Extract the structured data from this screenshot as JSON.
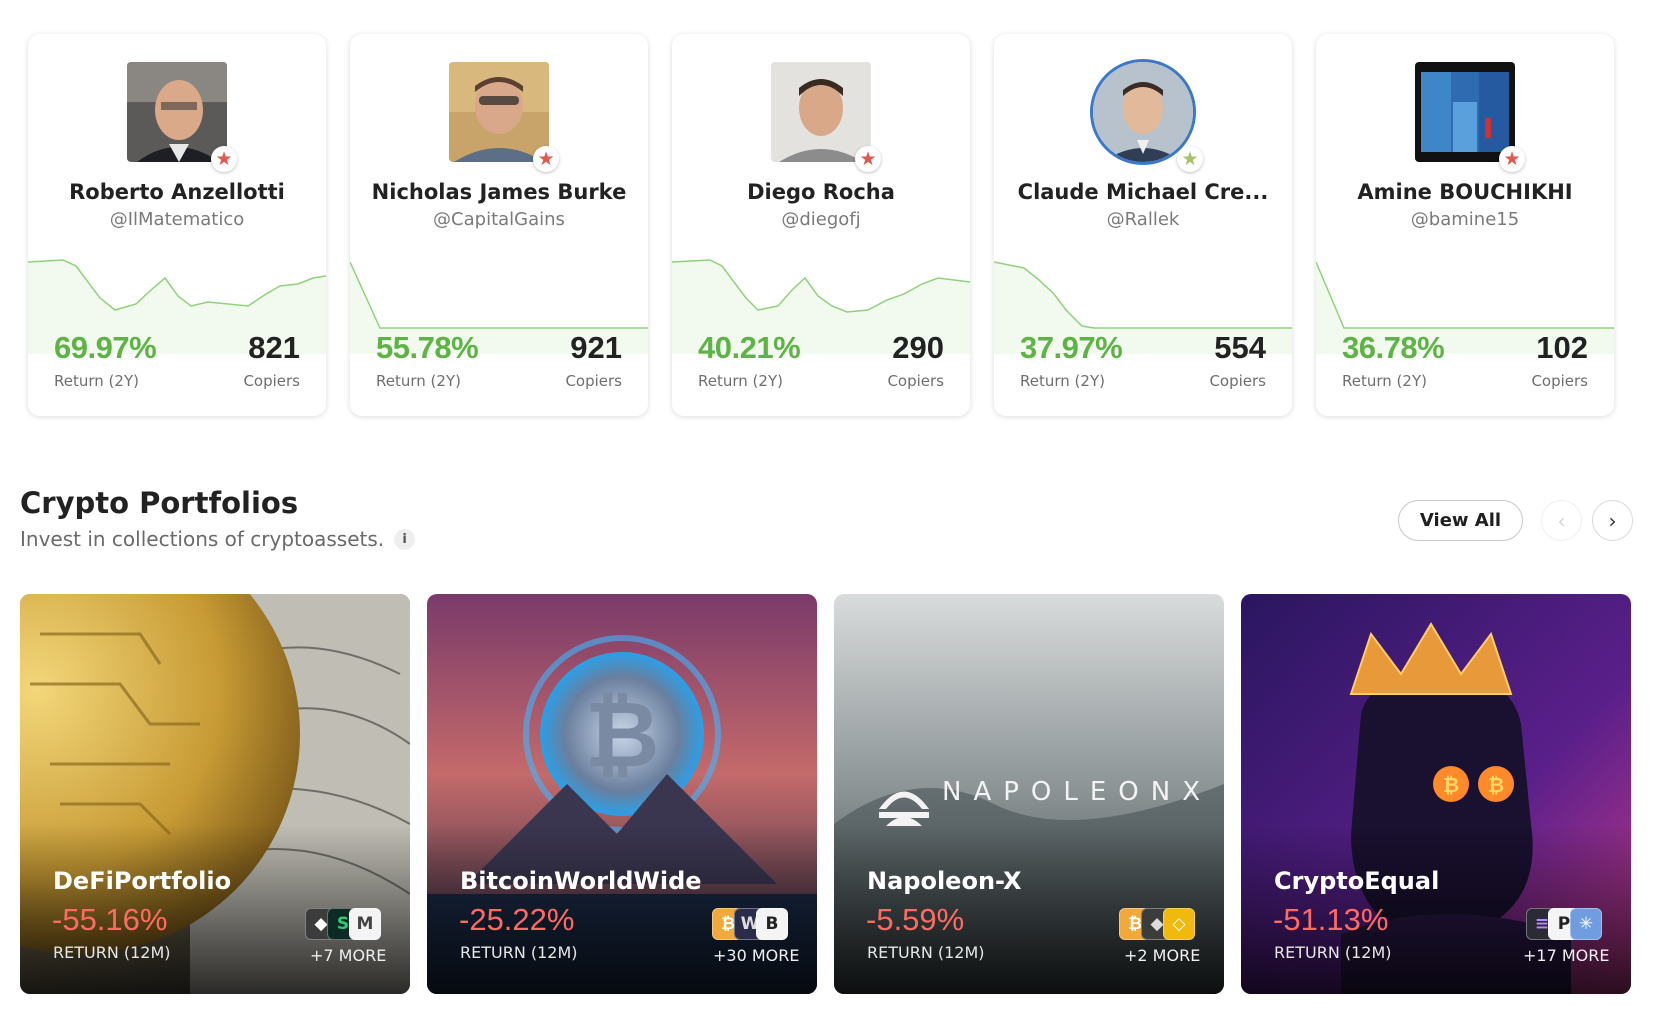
{
  "investors": [
    {
      "name": "Roberto Anzellotti",
      "handle": "@IlMatematico",
      "return": "69.97%",
      "return_label": "Return (2Y)",
      "copiers": "821",
      "copiers_label": "Copiers",
      "badge_color": "#e0594f",
      "avatar_icon": "person-photo"
    },
    {
      "name": "Nicholas James Burke",
      "handle": "@CapitalGains",
      "return": "55.78%",
      "return_label": "Return (2Y)",
      "copiers": "921",
      "copiers_label": "Copiers",
      "badge_color": "#e0594f",
      "avatar_icon": "person-photo"
    },
    {
      "name": "Diego Rocha",
      "handle": "@diegofj",
      "return": "40.21%",
      "return_label": "Return (2Y)",
      "copiers": "290",
      "copiers_label": "Copiers",
      "badge_color": "#e0594f",
      "avatar_icon": "person-photo"
    },
    {
      "name": "Claude Michael Cre...",
      "handle": "@Rallek",
      "return": "37.97%",
      "return_label": "Return (2Y)",
      "copiers": "554",
      "copiers_label": "Copiers",
      "badge_color": "#a5c26a",
      "avatar_icon": "person-photo"
    },
    {
      "name": "Amine BOUCHIKHI",
      "handle": "@bamine15",
      "return": "36.78%",
      "return_label": "Return (2Y)",
      "copiers": "102",
      "copiers_label": "Copiers",
      "badge_color": "#e0594f",
      "avatar_icon": "street-photo"
    }
  ],
  "section": {
    "title": "Crypto Portfolios",
    "subtitle": "Invest in collections of cryptoassets.",
    "info_icon": "i",
    "view_all": "View All",
    "prev_icon": "‹",
    "next_icon": "›"
  },
  "portfolios": [
    {
      "name": "DeFiPortfolio",
      "return": "-55.16%",
      "return_label": "RETURN (12M)",
      "more": "+7 MORE",
      "coins": [
        "◆",
        "S",
        "M"
      ]
    },
    {
      "name": "BitcoinWorldWide",
      "return": "-25.22%",
      "return_label": "RETURN (12M)",
      "more": "+30 MORE",
      "coins": [
        "₿",
        "W",
        "B"
      ]
    },
    {
      "name": "Napoleon-X",
      "return": "-5.59%",
      "return_label": "RETURN (12M)",
      "more": "+2 MORE",
      "coins": [
        "₿",
        "◆",
        "◇"
      ],
      "logo_text": "NAPOLEONX"
    },
    {
      "name": "CryptoEqual",
      "return": "-51.13%",
      "return_label": "RETURN (12M)",
      "more": "+17 MORE",
      "coins": [
        "≡",
        "P",
        "✳"
      ]
    }
  ],
  "colors": {
    "positive": "#5eb345",
    "negative": "#ff6b63",
    "sparkline": "#8fd27a"
  }
}
